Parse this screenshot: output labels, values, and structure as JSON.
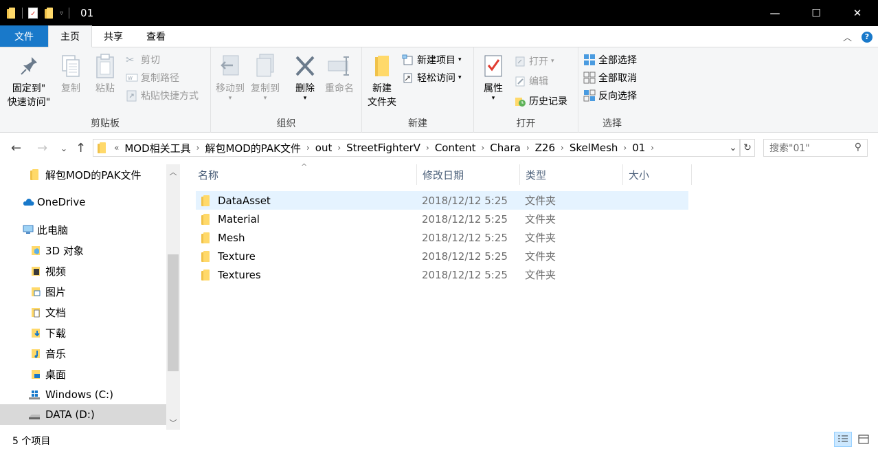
{
  "window": {
    "title": "01",
    "minimize": "—",
    "maximize": "☐",
    "close": "✕"
  },
  "tabs": [
    {
      "label": "文件"
    },
    {
      "label": "主页"
    },
    {
      "label": "共享"
    },
    {
      "label": "查看"
    }
  ],
  "ribbon": {
    "clipboard": {
      "label": "剪贴板",
      "pin": "固定到\"\n快速访问\"",
      "pin_line1": "固定到\"",
      "pin_line2": "快速访问\"",
      "copy": "复制",
      "paste": "粘贴",
      "cut": "剪切",
      "copy_path": "复制路径",
      "paste_shortcut": "粘贴快捷方式"
    },
    "organize": {
      "label": "组织",
      "move_to": "移动到",
      "copy_to": "复制到",
      "delete": "删除",
      "rename": "重命名"
    },
    "new": {
      "label": "新建",
      "new_folder_line1": "新建",
      "new_folder_line2": "文件夹",
      "new_item": "新建项目",
      "easy_access": "轻松访问"
    },
    "open": {
      "label": "打开",
      "properties": "属性",
      "open": "打开",
      "edit": "编辑",
      "history": "历史记录"
    },
    "select": {
      "label": "选择",
      "select_all": "全部选择",
      "select_none": "全部取消",
      "invert": "反向选择"
    }
  },
  "address": {
    "prefix": "«",
    "crumbs": [
      "MOD相关工具",
      "解包MOD的PAK文件",
      "out",
      "StreetFighterV",
      "Content",
      "Chara",
      "Z26",
      "SkelMesh",
      "01"
    ]
  },
  "search": {
    "placeholder": "搜索\"01\""
  },
  "nav": {
    "items": [
      {
        "label": "解包MOD的PAK文件"
      },
      {
        "label": "OneDrive"
      },
      {
        "label": "此电脑"
      },
      {
        "label": "3D 对象"
      },
      {
        "label": "视频"
      },
      {
        "label": "图片"
      },
      {
        "label": "文档"
      },
      {
        "label": "下载"
      },
      {
        "label": "音乐"
      },
      {
        "label": "桌面"
      },
      {
        "label": "Windows (C:)"
      },
      {
        "label": "DATA (D:)"
      }
    ]
  },
  "columns": {
    "name": "名称",
    "date": "修改日期",
    "type": "类型",
    "size": "大小"
  },
  "files": [
    {
      "name": "DataAsset",
      "date": "2018/12/12 5:25",
      "type": "文件夹"
    },
    {
      "name": "Material",
      "date": "2018/12/12 5:25",
      "type": "文件夹"
    },
    {
      "name": "Mesh",
      "date": "2018/12/12 5:25",
      "type": "文件夹"
    },
    {
      "name": "Texture",
      "date": "2018/12/12 5:25",
      "type": "文件夹"
    },
    {
      "name": "Textures",
      "date": "2018/12/12 5:25",
      "type": "文件夹"
    }
  ],
  "status": {
    "count": "5 个项目"
  },
  "colors": {
    "accent": "#1979ca",
    "folder": "#f0c24a",
    "selected_row": "#e5f3ff"
  }
}
